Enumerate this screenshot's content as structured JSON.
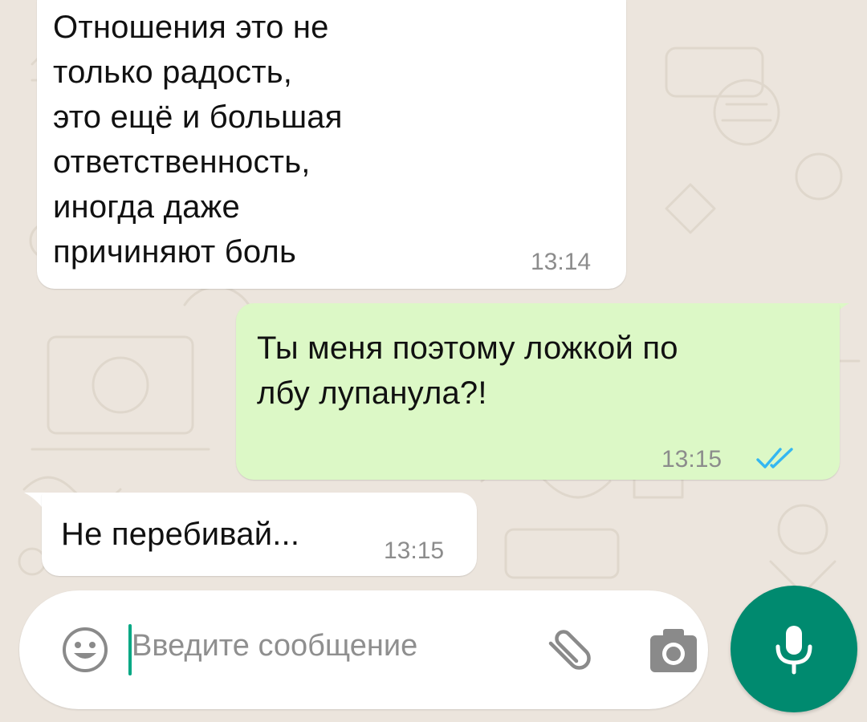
{
  "chat": {
    "messages": [
      {
        "direction": "incoming",
        "text": "Отношения это не\nтолько радость,\nэто ещё и большая\nответственность,\nиногда даже\nпричиняют боль",
        "time": "13:14"
      },
      {
        "direction": "outgoing",
        "text": "Ты меня поэтому ложкой по\nлбу лупанула?!",
        "time": "13:15",
        "status": "read"
      },
      {
        "direction": "incoming",
        "text": "Не перебивай...",
        "time": "13:15"
      }
    ]
  },
  "composer": {
    "placeholder": "Введите сообщение",
    "icons": {
      "emoji": "emoji-icon",
      "attach": "paperclip-icon",
      "camera": "camera-icon",
      "mic": "microphone-icon"
    }
  },
  "colors": {
    "background": "#ece5dd",
    "incoming_bubble": "#ffffff",
    "outgoing_bubble": "#dcf8c6",
    "read_ticks": "#34b7f1",
    "mic_button": "#008a6f",
    "timestamp": "#8c8c8c"
  }
}
